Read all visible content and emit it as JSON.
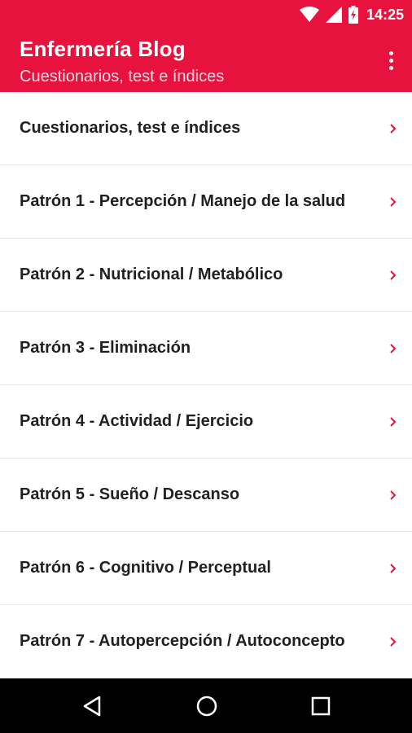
{
  "status_bar": {
    "time": "14:25",
    "icons": [
      "wifi-icon",
      "cell-signal-icon",
      "battery-charging-icon"
    ]
  },
  "app_bar": {
    "title": "Enfermería Blog",
    "subtitle": "Cuestionarios, test e índices",
    "menu_icon": "overflow-menu-icon"
  },
  "colors": {
    "primary": "#e8123e",
    "chevron": "#e8123e",
    "text": "#212121",
    "divider": "#e6e6e6",
    "nav_bar": "#000000"
  },
  "list": {
    "items": [
      {
        "label": "Cuestionarios, test e índices"
      },
      {
        "label": "Patrón 1 - Percepción / Manejo de la salud"
      },
      {
        "label": "Patrón 2 - Nutricional / Metabólico"
      },
      {
        "label": "Patrón 3 - Eliminación"
      },
      {
        "label": "Patrón 4 - Actividad / Ejercicio"
      },
      {
        "label": "Patrón 5 - Sueño / Descanso"
      },
      {
        "label": "Patrón 6 - Cognitivo / Perceptual"
      },
      {
        "label": "Patrón 7 - Autopercepción / Autoconcepto"
      }
    ]
  },
  "nav_bar": {
    "buttons": [
      "back-icon",
      "home-icon",
      "recents-icon"
    ]
  }
}
